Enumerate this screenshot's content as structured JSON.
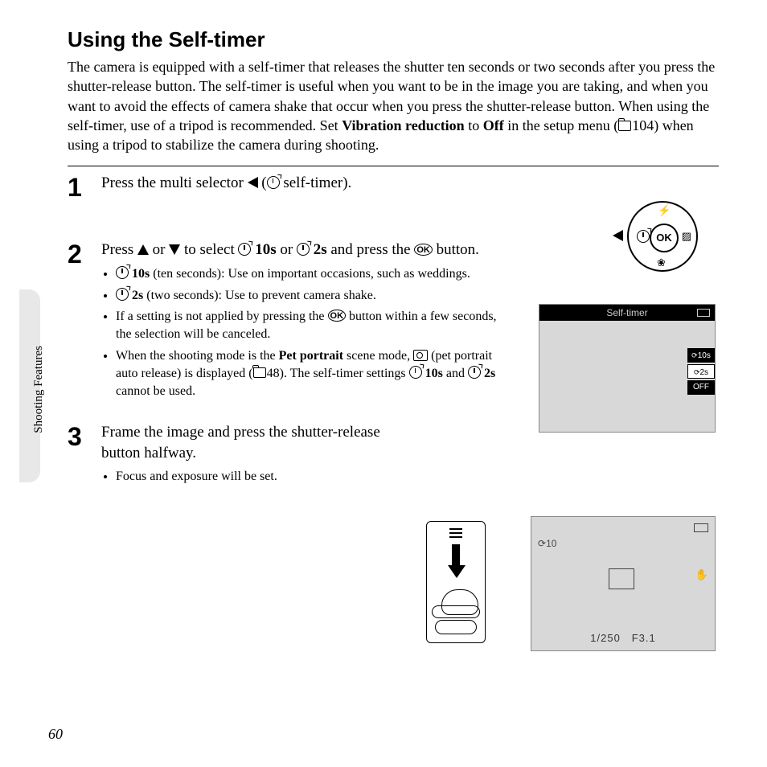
{
  "title": "Using the Self-timer",
  "intro_a": "The camera is equipped with a self-timer that releases the shutter ten seconds or two seconds after you press the shutter-release button. The self-timer is useful when you want to be in the image you are taking, and when you want to avoid the effects of camera shake that occur when you press the shutter-release button. When using the self-timer, use of a tripod is recommended. Set ",
  "intro_b1": "Vibration reduction",
  "intro_c": " to ",
  "intro_b2": "Off",
  "intro_d": " in the setup menu (",
  "intro_ref": "104",
  "intro_e": ") when using a tripod to stabilize the camera during shooting.",
  "step1": {
    "num": "1",
    "lead_a": "Press the multi selector ",
    "lead_b": " (",
    "lead_c": " self-timer).",
    "ok": "OK"
  },
  "step2": {
    "num": "2",
    "lead_a": "Press ",
    "lead_b": " or ",
    "lead_c": " to select ",
    "ten": "10s",
    "lead_d": " or ",
    "two": "2s",
    "lead_e": " and press the ",
    "ok": "OK",
    "lead_f": " button.",
    "b1a": "10s",
    "b1b": " (ten seconds): Use on important occasions, such as weddings.",
    "b2a": "2s",
    "b2b": " (two seconds): Use to prevent camera shake.",
    "b3a": "If a setting is not applied by pressing the ",
    "b3b": " button within a few seconds, the selection will be canceled.",
    "b4a": "When the shooting mode is the ",
    "b4pet": "Pet portrait",
    "b4b": " scene mode, ",
    "b4c": " (pet portrait auto release) is displayed (",
    "b4ref": "48",
    "b4d": "). The self-timer settings ",
    "b4e": " and ",
    "b4f": " cannot be used.",
    "lcd_title": "Self-timer",
    "opt10": "10s",
    "opt2": "2s",
    "optoff": "OFF"
  },
  "step3": {
    "num": "3",
    "lead": "Frame the image and press the shutter-release button halfway.",
    "b1": "Focus and exposure will be set.",
    "lcd_timer": "10",
    "lcd_shutter": "1/250",
    "lcd_f": "F3.1"
  },
  "side": "Shooting Features",
  "pagenum": "60"
}
